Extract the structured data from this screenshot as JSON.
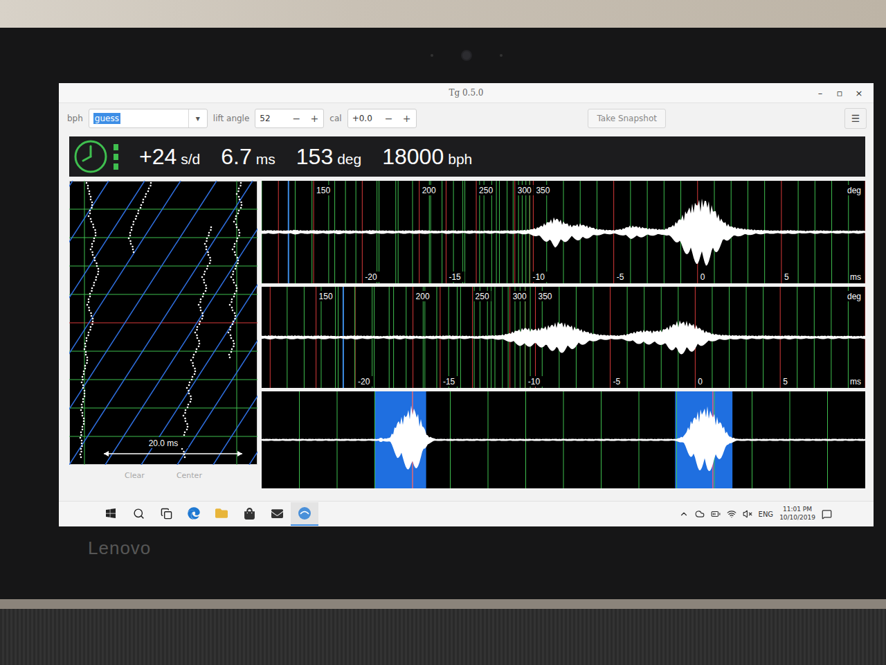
{
  "window": {
    "title": "Tg 0.5.0",
    "controls": [
      "–",
      "▫",
      "×"
    ]
  },
  "toolbar": {
    "bph": {
      "label": "bph",
      "value": "guess",
      "selected": true,
      "arrow": "▾"
    },
    "lift_angle": {
      "label": "lift angle",
      "value": "52",
      "minus": "−",
      "plus": "+"
    },
    "cal": {
      "label": "cal",
      "value": "+0.0",
      "minus": "−",
      "plus": "+"
    },
    "snapshot": "Take Snapshot",
    "menu": "☰"
  },
  "status": {
    "ok": true,
    "signal": [
      true,
      true,
      true
    ],
    "readings": [
      {
        "value": "+24",
        "unit": "s/d"
      },
      {
        "value": "6.7",
        "unit": "ms"
      },
      {
        "value": "153",
        "unit": "deg"
      },
      {
        "value": "18000",
        "unit": "bph"
      }
    ]
  },
  "paper_strip": {
    "scale": "20.0 ms",
    "traces": [
      {
        "from_row": 0,
        "ms": [
          2.5,
          2.7,
          2.9,
          3.1,
          3.3,
          3.0,
          2.8,
          3.2,
          3.5,
          3.8,
          3.6,
          3.3,
          3.1,
          3.4,
          3.7,
          4.0,
          4.2,
          3.9,
          3.6,
          3.3,
          3.0,
          2.8,
          2.6,
          2.9,
          3.2,
          3.4,
          3.1,
          2.8,
          2.5,
          2.3,
          2.2,
          2.4,
          2.6,
          2.3,
          2.1,
          1.9,
          1.8,
          2.0,
          2.2,
          2.0,
          1.8,
          1.7,
          1.9,
          2.1,
          1.9,
          1.7,
          1.6,
          1.8,
          1.7,
          1.6
        ]
      },
      {
        "from_row": 0,
        "ms": [
          11.8,
          11.5,
          11.1,
          10.7,
          10.4,
          10.0,
          9.7,
          9.3,
          9.0,
          8.8,
          8.6,
          8.9,
          9.2
        ]
      },
      {
        "from_row": 8,
        "ms": [
          20.5,
          20.2,
          19.9,
          19.6,
          19.8,
          20.1,
          20.4,
          20.0,
          19.6,
          19.2,
          19.5,
          19.8,
          19.4,
          19.0,
          18.7,
          19.0,
          19.3,
          18.9,
          18.5,
          18.2,
          18.5,
          18.8,
          18.4,
          18.0,
          17.6,
          17.9,
          18.2,
          17.8,
          17.4,
          17.0,
          17.3,
          17.6,
          17.2,
          16.8,
          16.5,
          16.8,
          17.1,
          16.7,
          16.3,
          16.0,
          16.3,
          16.6
        ]
      },
      {
        "from_row": 0,
        "ms": [
          24.8,
          24.5,
          24.2,
          24.6,
          24.9,
          24.5,
          24.1,
          23.8,
          24.2,
          24.6,
          24.3,
          23.9,
          23.6,
          24.0,
          24.4,
          24.1,
          23.7,
          23.4,
          23.8,
          24.2,
          23.9,
          23.5,
          23.2,
          23.6,
          24.0,
          23.7,
          23.3,
          23.0,
          23.4,
          23.8,
          23.5,
          23.1
        ]
      }
    ],
    "buttons": [
      {
        "label": "Clear",
        "disabled": true
      },
      {
        "label": "Center",
        "disabled": true
      }
    ]
  },
  "waveforms": [
    {
      "axis_ms": [
        -26,
        10
      ],
      "marker_ms": -24.4,
      "deg_unit": "deg",
      "ms_unit": "ms",
      "deg_ticks": [
        {
          "label": "150",
          "ms": -22.9
        },
        {
          "label": "200",
          "ms": -16.6
        },
        {
          "label": "250",
          "ms": -13.2
        },
        {
          "label": "300",
          "ms": -10.9
        },
        {
          "label": "350",
          "ms": -9.8
        }
      ],
      "ms_ticks": [
        {
          "label": "-20",
          "ms": -20
        },
        {
          "label": "-15",
          "ms": -15
        },
        {
          "label": "-10",
          "ms": -10
        },
        {
          "label": "-5",
          "ms": -5
        },
        {
          "label": "0",
          "ms": 0
        },
        {
          "label": "5",
          "ms": 5
        }
      ],
      "envelope": [
        0.05,
        0.06,
        0.05,
        0.05,
        0.07,
        0.05,
        0.06,
        0.05,
        0.05,
        0.06,
        0.05,
        0.05,
        0.04,
        0.06,
        0.05,
        0.05,
        0.04,
        0.05,
        0.05,
        0.06,
        0.05,
        0.04,
        0.05,
        0.05,
        0.04,
        0.05,
        0.04,
        0.05,
        0.04,
        0.05,
        0.05,
        0.06,
        0.08,
        0.15,
        0.3,
        0.45,
        0.32,
        0.2,
        0.26,
        0.18,
        0.1,
        0.07,
        0.06,
        0.1,
        0.2,
        0.17,
        0.12,
        0.1,
        0.08,
        0.2,
        0.45,
        0.75,
        0.95,
        1.0,
        0.7,
        0.35,
        0.18,
        0.12,
        0.09,
        0.07,
        0.06,
        0.05,
        0.05,
        0.06,
        0.05,
        0.04,
        0.05,
        0.05,
        0.04,
        0.05,
        0.04,
        0.05,
        0.04
      ]
    },
    {
      "axis_ms": [
        -25.5,
        10
      ],
      "marker_ms": -20.7,
      "deg_unit": "deg",
      "ms_unit": "ms",
      "deg_ticks": [
        {
          "label": "150",
          "ms": -22.3
        },
        {
          "label": "200",
          "ms": -16.6
        },
        {
          "label": "250",
          "ms": -13.1
        },
        {
          "label": "300",
          "ms": -10.9
        },
        {
          "label": "350",
          "ms": -9.4
        }
      ],
      "ms_ticks": [
        {
          "label": "-20",
          "ms": -20
        },
        {
          "label": "-15",
          "ms": -15
        },
        {
          "label": "-10",
          "ms": -10
        },
        {
          "label": "-5",
          "ms": -5
        },
        {
          "label": "0",
          "ms": 0
        },
        {
          "label": "5",
          "ms": 5
        }
      ],
      "envelope": [
        0.05,
        0.06,
        0.05,
        0.05,
        0.06,
        0.05,
        0.05,
        0.06,
        0.05,
        0.04,
        0.05,
        0.06,
        0.05,
        0.05,
        0.04,
        0.05,
        0.06,
        0.05,
        0.05,
        0.04,
        0.05,
        0.05,
        0.06,
        0.05,
        0.05,
        0.04,
        0.05,
        0.06,
        0.07,
        0.12,
        0.22,
        0.3,
        0.25,
        0.3,
        0.38,
        0.48,
        0.4,
        0.3,
        0.2,
        0.12,
        0.08,
        0.07,
        0.06,
        0.1,
        0.18,
        0.22,
        0.2,
        0.22,
        0.35,
        0.5,
        0.48,
        0.38,
        0.22,
        0.12,
        0.08,
        0.07,
        0.06,
        0.06,
        0.05,
        0.06,
        0.05,
        0.05,
        0.06,
        0.05,
        0.05,
        0.04,
        0.05,
        0.05,
        0.04,
        0.05,
        0.04,
        0.05
      ]
    }
  ],
  "period_view": {
    "axis_ms": [
      0,
      400
    ],
    "windows": [
      {
        "start": 75,
        "end": 109,
        "mark": 100
      },
      {
        "start": 274,
        "end": 312,
        "mark": 299
      }
    ],
    "envelope": [
      0.03,
      0.03,
      0.03,
      0.03,
      0.03,
      0.03,
      0.03,
      0.03,
      0.03,
      0.03,
      0.03,
      0.03,
      0.03,
      0.03,
      0.03,
      0.03,
      0.03,
      0.06,
      0.5,
      0.7,
      0.95,
      0.6,
      0.12,
      0.03,
      0.03,
      0.03,
      0.03,
      0.03,
      0.03,
      0.03,
      0.03,
      0.03,
      0.03,
      0.03,
      0.03,
      0.03,
      0.03,
      0.03,
      0.03,
      0.03,
      0.03,
      0.03,
      0.03,
      0.03,
      0.03,
      0.03,
      0.03,
      0.03,
      0.03,
      0.03,
      0.03,
      0.03,
      0.03,
      0.03,
      0.03,
      0.03,
      0.12,
      0.55,
      0.8,
      0.9,
      0.7,
      0.45,
      0.1,
      0.03,
      0.03,
      0.03,
      0.03,
      0.03,
      0.03,
      0.03,
      0.03,
      0.03,
      0.03,
      0.03,
      0.03,
      0.03,
      0.03,
      0.03,
      0.03,
      0.03,
      0.03
    ]
  },
  "taskbar": {
    "apps": [
      {
        "kind": "start",
        "selected": false
      },
      {
        "kind": "search",
        "selected": false
      },
      {
        "kind": "taskview",
        "selected": false
      },
      {
        "kind": "edge",
        "selected": false
      },
      {
        "kind": "explorer",
        "selected": false
      },
      {
        "kind": "store",
        "selected": false
      },
      {
        "kind": "mail",
        "selected": false
      },
      {
        "kind": "tg",
        "selected": true
      }
    ],
    "ime": "ENG",
    "time": "11:01 PM",
    "date": "10/10/2019"
  },
  "device": {
    "brand": "Lenovo"
  }
}
